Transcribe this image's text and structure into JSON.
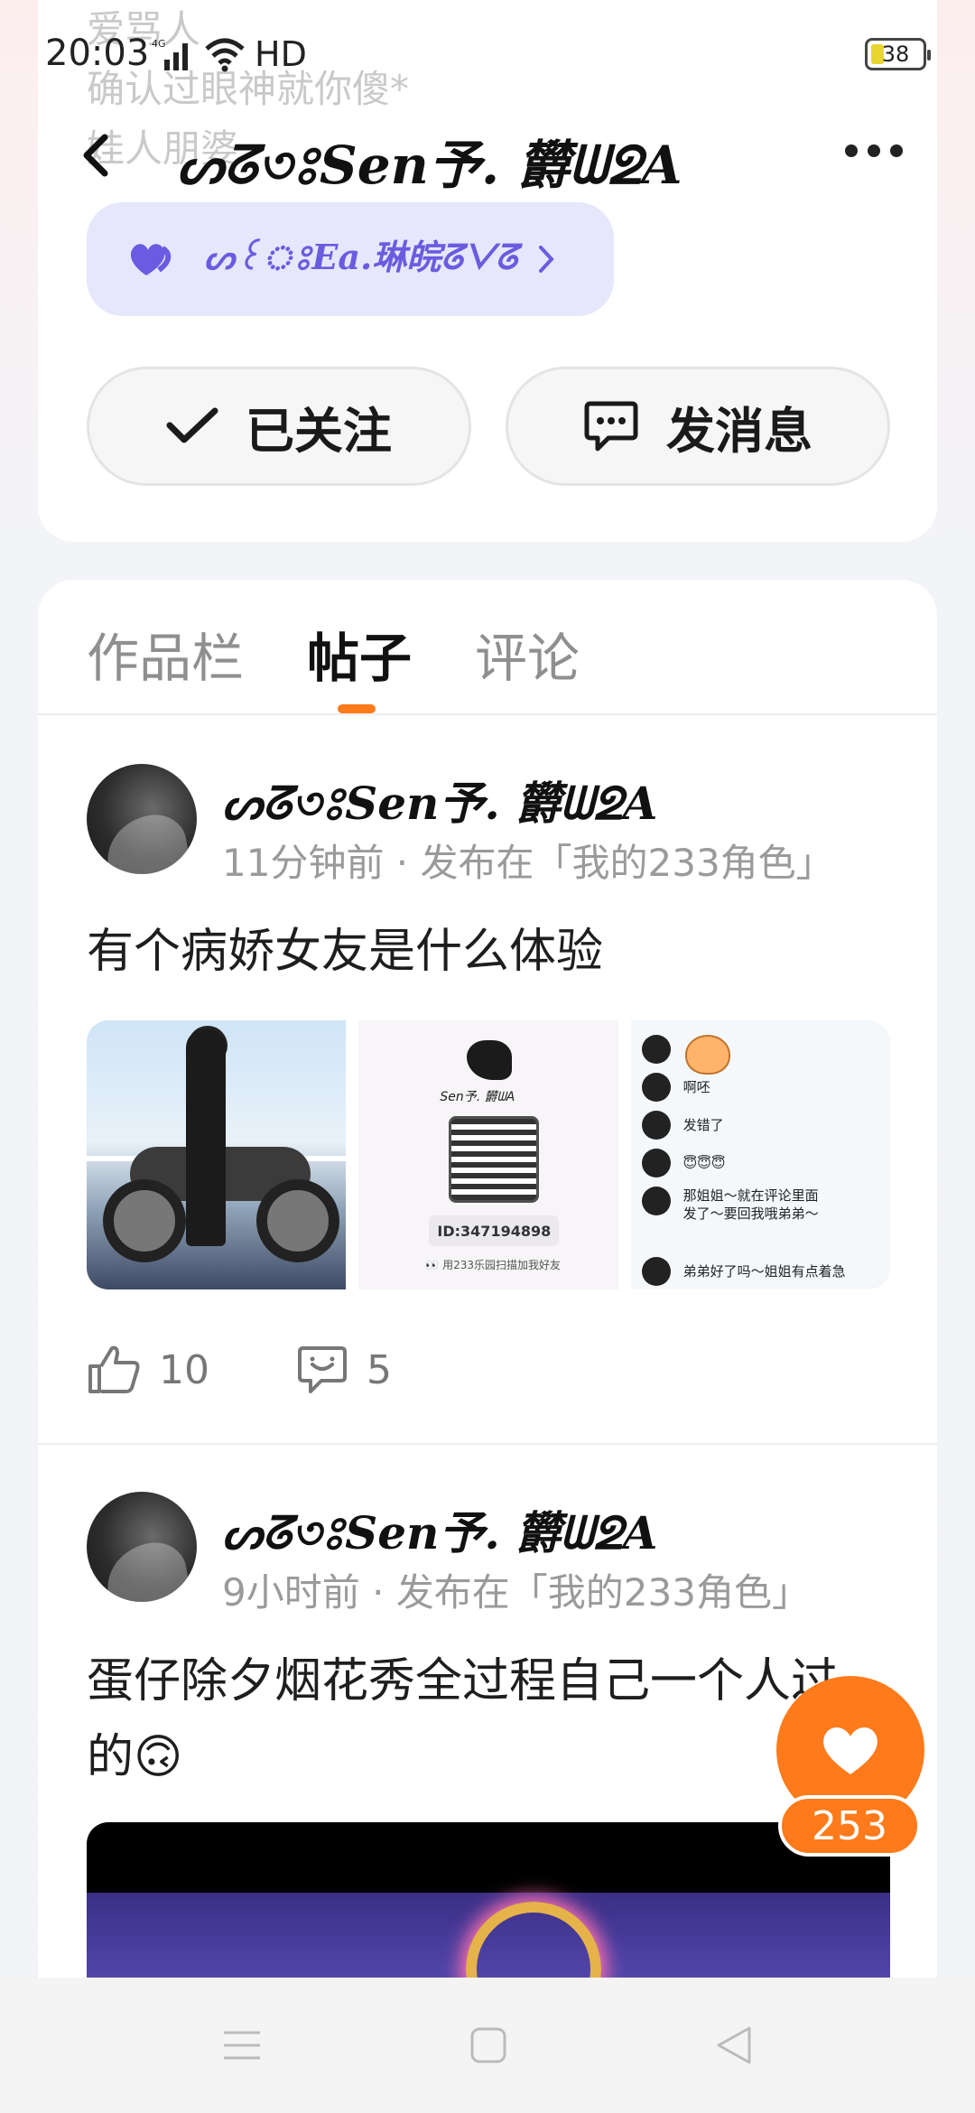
{
  "status_bar": {
    "time": "20:03",
    "network": "4G",
    "hd": "HD",
    "battery": "38"
  },
  "profile": {
    "bio_lines": [
      "爱骂人",
      "确认过眼神就你傻*",
      "娃人朋婆"
    ],
    "header_title": "ᔕᘔ৩ঃSen予. 欝ᗯᘖA",
    "fan_badge": "ᔕ꒰ঃEa.琳皖ᘔᐯᘔ",
    "follow_label": "已关注",
    "message_label": "发消息"
  },
  "tabs": [
    {
      "label": "作品栏",
      "active": false
    },
    {
      "label": "帖子",
      "active": true
    },
    {
      "label": "评论",
      "active": false
    }
  ],
  "posts": [
    {
      "author": "ᔕᘔ৩ঃSen予. 欝ᗯᘖA",
      "meta": "11分钟前 · 发布在「我的233角色」",
      "text": "有个病娇女友是什么体验",
      "likes": "10",
      "comments": "5",
      "images": {
        "qr_title": "Sen予. 欝ᗯA",
        "qr_id": "ID:347194898",
        "qr_caption": "👀 用233乐园扫描加我好友",
        "chat": [
          "啊呸",
          "发错了",
          "😇😇😇",
          "那姐姐～就在评论里面发了～要回我哦弟弟～",
          "弟弟好了吗～姐姐有点着急"
        ]
      }
    },
    {
      "author": "ᔕᘔ৩ঃSen予. 欝ᗯᘖA",
      "meta": "9小时前 · 发布在「我的233角色」",
      "text": "蛋仔除夕烟花秀全过程自己一个人过的🙃"
    }
  ],
  "like_fab": {
    "count": "253"
  },
  "colors": {
    "accent": "#ff7a1a",
    "badge_bg": "#e6e7fb",
    "badge_text": "#6a5ce0"
  }
}
